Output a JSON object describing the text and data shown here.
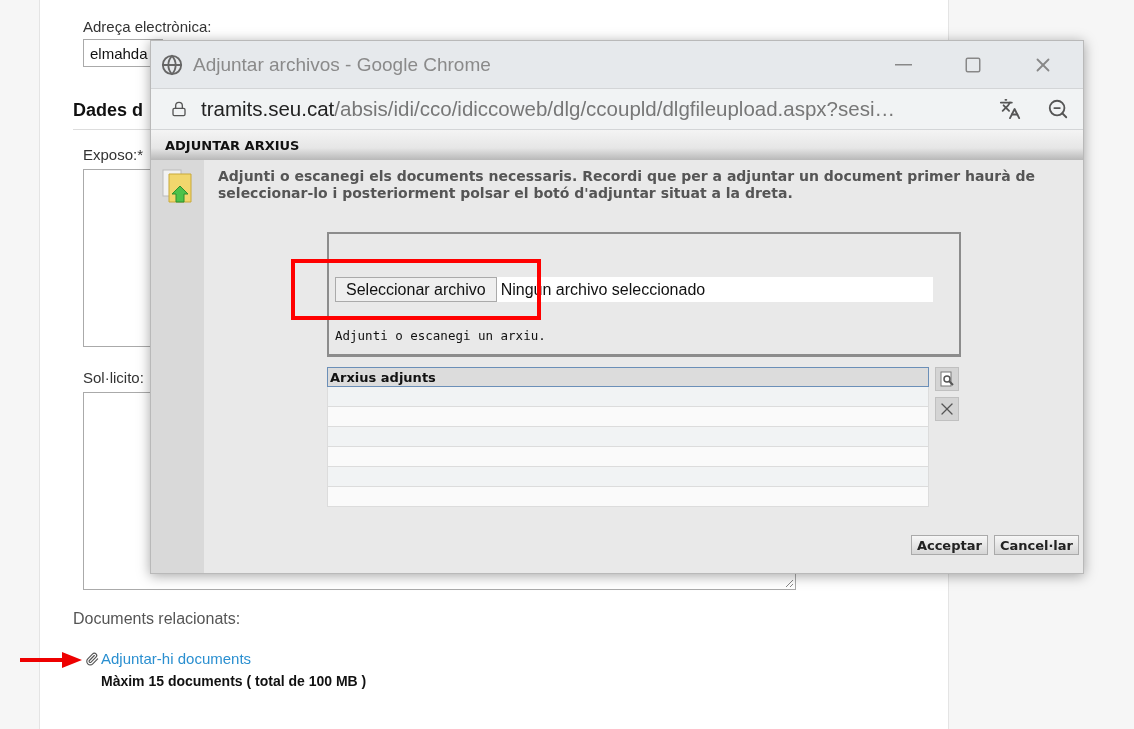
{
  "page": {
    "email_label": "Adreça electrònica:",
    "email_value": "elmahda",
    "section_heading": "Dades d",
    "expose_label": "Exposo:*",
    "request_label": "Sol·licito:",
    "documents_label": "Documents relacionats:",
    "attach_link": "Adjuntar-hi documents",
    "limit_note": "Màxim 15 documents ( total de 100 MB )"
  },
  "browser_window": {
    "title": "Adjuntar archivos - Google Chrome",
    "url_host": "tramits.seu.cat",
    "url_path": "/absis/idi/cco/idiccoweb/dlg/ccoupld/dlgfileupload.aspx?sesi…"
  },
  "dialog": {
    "header": "ADJUNTAR ARXIUS",
    "instructions": "Adjunti o escanegi els documents necessaris. Recordi que per a adjuntar un document primer haurà de seleccionar-lo i posteriorment polsar el botó d'adjuntar situat a la dreta.",
    "file_button": "Seleccionar archivo",
    "file_status": "Ningún archivo seleccionado",
    "hint": "Adjunti o escanegi un arxiu.",
    "table": {
      "columns": [
        "Arxius adjunts"
      ]
    },
    "buttons": [
      "Acceptar",
      "Cancel·lar"
    ]
  },
  "annotations": {
    "highlight_box": true,
    "pointer_arrow": true
  }
}
